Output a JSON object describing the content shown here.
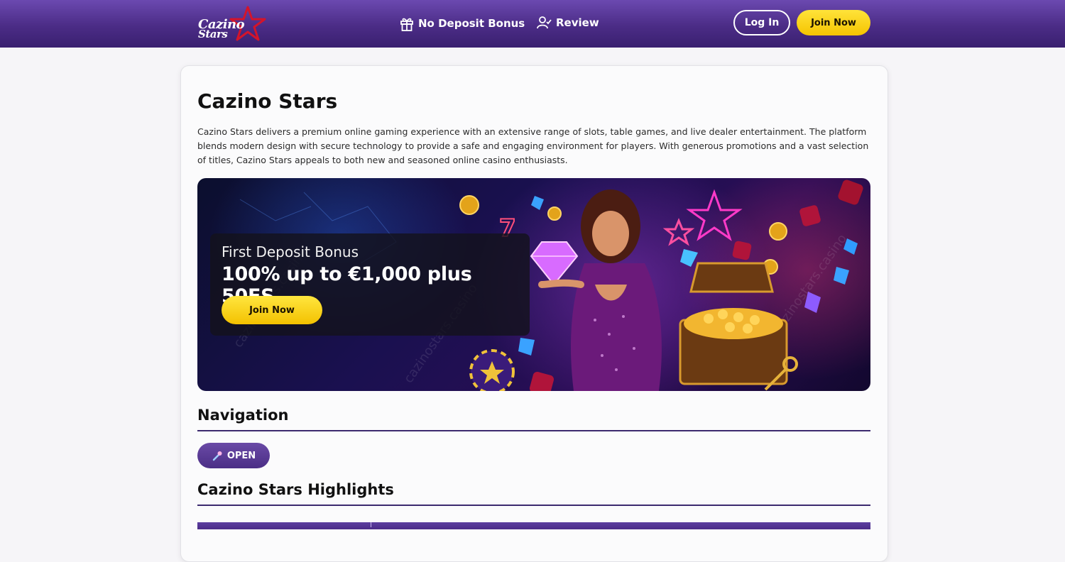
{
  "header": {
    "logo_text_line1": "Cazino",
    "logo_text_line2": "Stars",
    "nav": [
      {
        "label": "No Deposit Bonus",
        "icon": "gift-icon"
      },
      {
        "label": "Review",
        "icon": "user-review-icon"
      }
    ],
    "login_label": "Log In",
    "join_label": "Join Now"
  },
  "main": {
    "title": "Cazino Stars",
    "intro": "Cazino Stars delivers a premium online gaming experience with an extensive range of slots, table games, and live dealer entertainment. The platform blends modern design with secure technology to provide a safe and engaging environment for players. With generous promotions and a vast selection of titles, Cazino Stars appeals to both new and seasoned online casino enthusiasts.",
    "banner": {
      "promo_subtitle": "First Deposit Bonus",
      "promo_title": "100% up to €1,000 plus 50FS",
      "join_label": "Join Now",
      "watermark": "cazinostars.casino"
    },
    "navigation": {
      "heading": "Navigation",
      "open_label": "OPEN",
      "open_icon": "magic-wand-icon"
    },
    "highlights": {
      "heading": "Cazino Stars Highlights"
    }
  },
  "colors": {
    "header_purple": "#4b2c86",
    "accent_yellow": "#f5c400",
    "rule_color": "#3b2a6e"
  }
}
